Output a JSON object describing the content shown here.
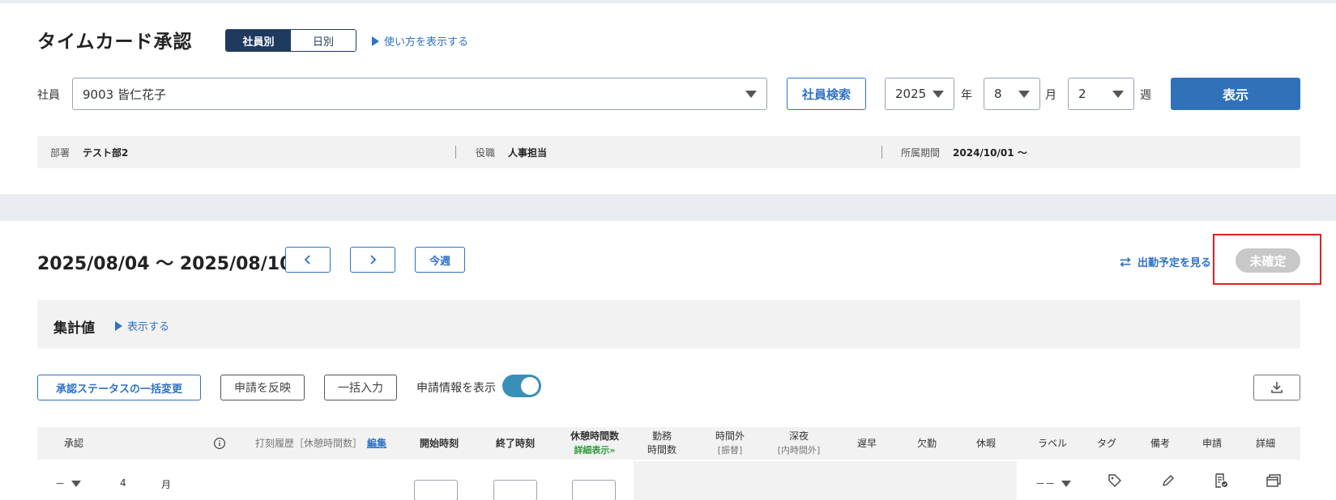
{
  "header": {
    "title": "タイムカード承認",
    "view_toggle": [
      "社員別",
      "日別"
    ],
    "help_link": "使い方を表示する"
  },
  "filters": {
    "employee_label": "社員",
    "employee_value": "9003 皆仁花子",
    "search_button": "社員検索",
    "year": "2025",
    "year_unit": "年",
    "month": "8",
    "month_unit": "月",
    "week": "2",
    "week_unit": "週",
    "display_button": "表示"
  },
  "info": {
    "department_label": "部署",
    "department_value": "テスト部2",
    "position_label": "役職",
    "position_value": "人事担当",
    "period_label": "所属期間",
    "period_value": "2024/10/01 〜"
  },
  "week_nav": {
    "range": "2025/08/04 〜 2025/08/10",
    "this_week": "今週",
    "schedule_link": "出勤予定を見る",
    "status": "未確定"
  },
  "summary": {
    "title": "集計値",
    "toggle_link": "表示する"
  },
  "actions": {
    "bulk_status": "承認ステータスの一括変更",
    "reflect_request": "申請を反映",
    "bulk_input": "一括入力",
    "show_request_label": "申請情報を表示",
    "show_request_on": true
  },
  "table": {
    "headers": {
      "approval": "承認",
      "history": "打刻履歴［休憩時間数］",
      "edit": "編集",
      "start": "開始時刻",
      "end": "終了時刻",
      "break_line1": "休憩時間数",
      "break_line2": "詳細表示»",
      "work_line1": "勤務",
      "work_line2": "時間数",
      "overtime_line1": "時間外",
      "overtime_line2": "[振替]",
      "night_line1": "深夜",
      "night_line2": "[内時間外]",
      "late": "遅早",
      "absence": "欠勤",
      "leave": "休暇",
      "label": "ラベル",
      "tag": "タグ",
      "note": "備考",
      "request": "申請",
      "detail": "詳細"
    },
    "row": {
      "approval": "－",
      "day": "4",
      "month_unit": "月",
      "label": "－－"
    }
  }
}
